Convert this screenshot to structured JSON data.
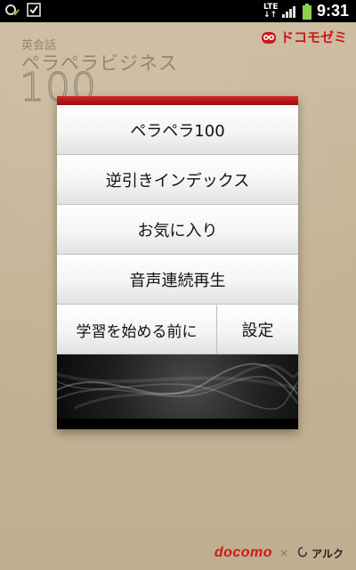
{
  "status_bar": {
    "network_label_top": "LTE",
    "network_label_bottom": "↓↑",
    "time": "9:31"
  },
  "app_title": {
    "small": "英会話",
    "main": "ペラペラビジネス",
    "number": "100"
  },
  "brand": {
    "name": "ドコモゼミ",
    "color": "#c81a1a"
  },
  "menu": {
    "items": [
      {
        "label": "ペラペラ100"
      },
      {
        "label": "逆引きインデックス"
      },
      {
        "label": "お気に入り"
      },
      {
        "label": "音声連続再生"
      }
    ],
    "before_start_label": "学習を始める前に",
    "settings_label": "設定"
  },
  "footer": {
    "docomo": "docomo",
    "times": "×",
    "alc": "アルク"
  },
  "colors": {
    "accent_red": "#c81a1a",
    "background": "#c8b79b"
  }
}
